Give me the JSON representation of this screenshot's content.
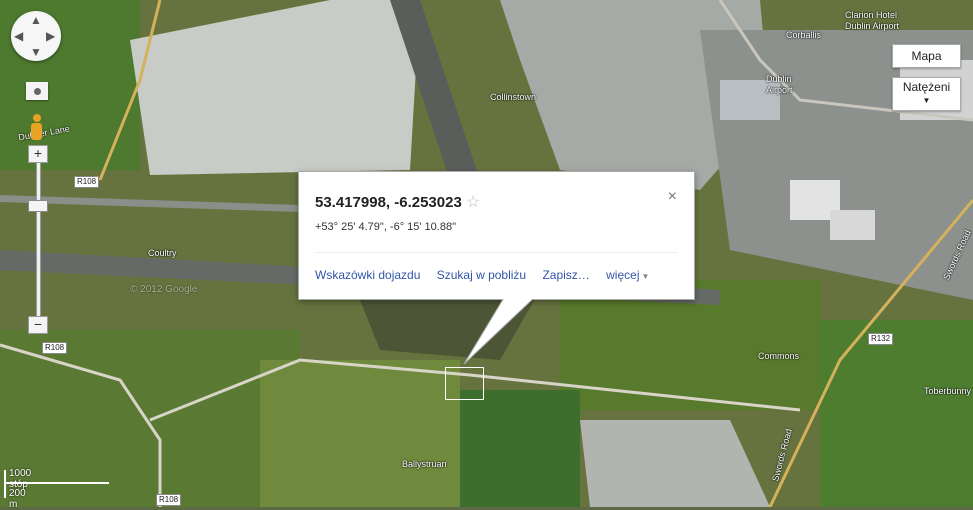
{
  "map": {
    "labels": {
      "collinstown": "Collinstown",
      "dublin_airport": "Dublin\nAirport",
      "corballis": "Corballis",
      "clarion": "Clarion Hotel\nDublin Airport",
      "coultry": "Coultry",
      "commons": "Commons",
      "ballystruan": "Ballystruan",
      "toberbunny": "Toberbunny",
      "swords_road_1": "Swords Road",
      "swords_road_2": "Swords Road",
      "dubber_lane": "Dubber Lane",
      "copyright": "© 2012 Google"
    },
    "road_shields": {
      "r108_a": "R108",
      "r108_b": "R108",
      "r108_c": "R108",
      "r132": "R132"
    }
  },
  "controls": {
    "maptype_map": "Mapa",
    "maptype_overlay": "Natężeni",
    "zoom_in": "+",
    "zoom_out": "−"
  },
  "scale": {
    "imperial": "1000 stóp",
    "metric": "200 m"
  },
  "bubble": {
    "coords": "53.417998, -6.253023",
    "star": "☆",
    "dms": "+53° 25' 4.79\", -6° 15' 10.88\"",
    "close": "×",
    "link_directions": "Wskazówki dojazdu",
    "link_nearby": "Szukaj w pobliżu",
    "link_save": "Zapisz…",
    "link_more": "więcej"
  }
}
